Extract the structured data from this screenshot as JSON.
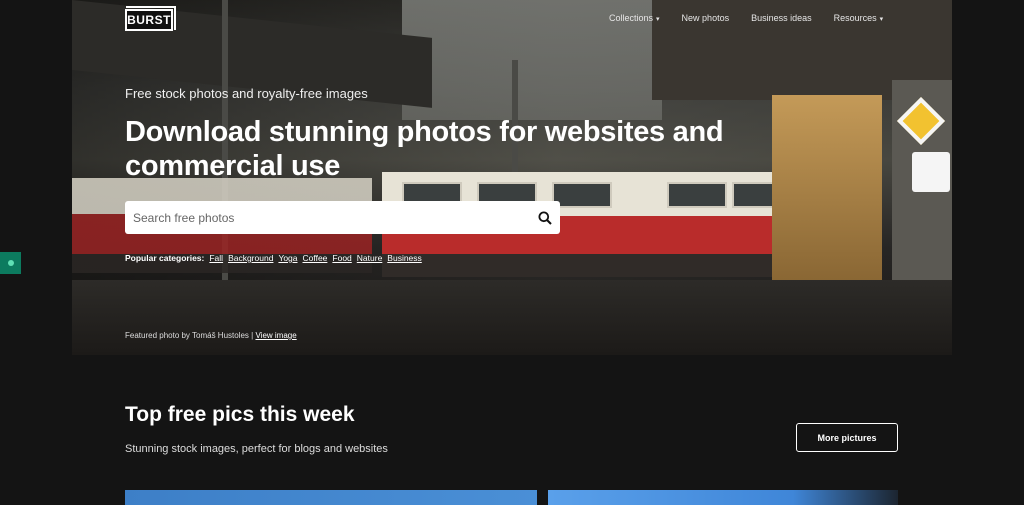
{
  "brand": {
    "logo_text": "BURST"
  },
  "nav": {
    "items": [
      {
        "label": "Collections",
        "has_dropdown": true
      },
      {
        "label": "New photos",
        "has_dropdown": false
      },
      {
        "label": "Business ideas",
        "has_dropdown": false
      },
      {
        "label": "Resources",
        "has_dropdown": true
      }
    ]
  },
  "hero": {
    "subtitle": "Free stock photos and royalty-free images",
    "headline": "Download stunning photos for websites and commercial use",
    "search": {
      "placeholder": "Search free photos",
      "value": ""
    },
    "categories": {
      "label": "Popular categories:",
      "items": [
        "Fall",
        "Background",
        "Yoga",
        "Coffee",
        "Food",
        "Nature",
        "Business"
      ]
    },
    "credit": {
      "text": "Featured photo by Tomáš Hustoles |",
      "link": "View image"
    }
  },
  "section": {
    "title": "Top free pics this week",
    "subtitle": "Stunning stock images, perfect for blogs and websites",
    "more_button": "More pictures"
  },
  "icons": {
    "search": "search-icon",
    "chevron": "chevron-down-icon"
  },
  "colors": {
    "background": "#141414",
    "side_tab": "#0c7b5f",
    "accent_text": "#ffffff"
  }
}
